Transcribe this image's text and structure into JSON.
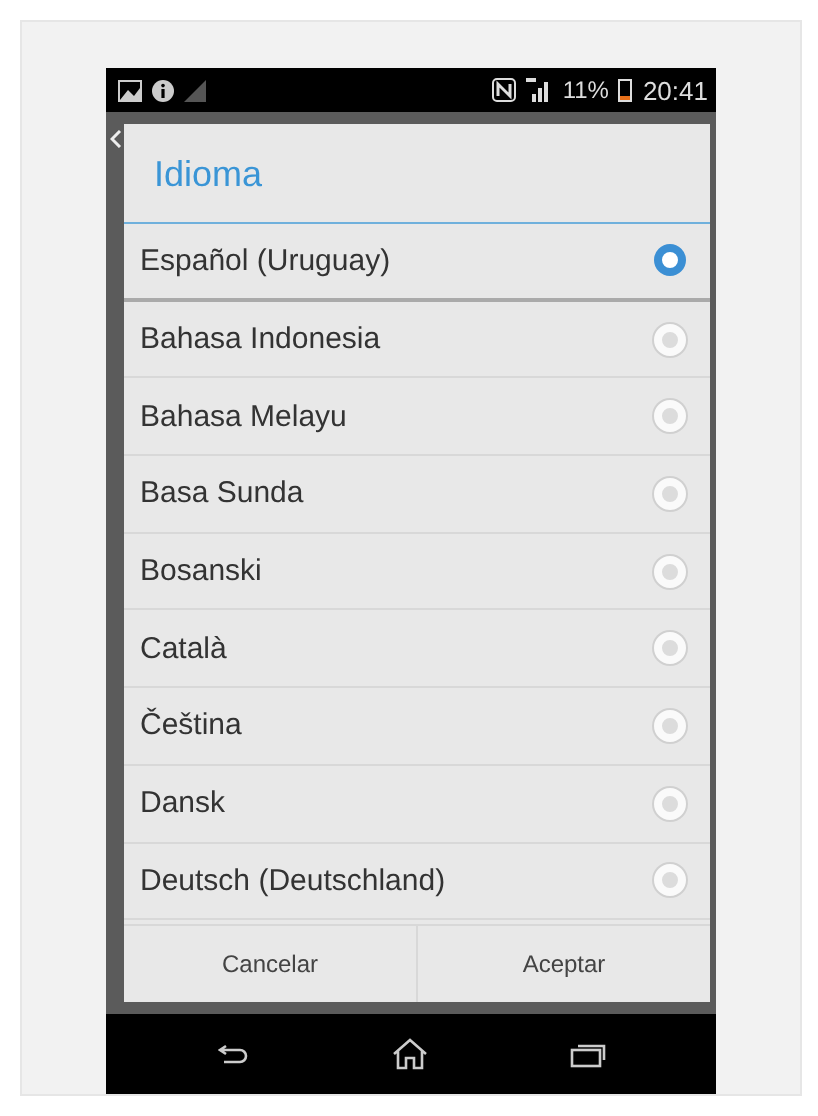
{
  "status_bar": {
    "battery_text": "11%",
    "time": "20:41"
  },
  "dialog": {
    "title": "Idioma",
    "options": [
      {
        "label": "Español (Uruguay)",
        "selected": true
      },
      {
        "label": "Bahasa Indonesia",
        "selected": false
      },
      {
        "label": "Bahasa Melayu",
        "selected": false
      },
      {
        "label": "Basa Sunda",
        "selected": false
      },
      {
        "label": "Bosanski",
        "selected": false
      },
      {
        "label": "Català",
        "selected": false
      },
      {
        "label": "Čeština",
        "selected": false
      },
      {
        "label": "Dansk",
        "selected": false
      },
      {
        "label": "Deutsch (Deutschland)",
        "selected": false
      }
    ],
    "buttons": [
      "Cancelar",
      "Aceptar"
    ]
  }
}
